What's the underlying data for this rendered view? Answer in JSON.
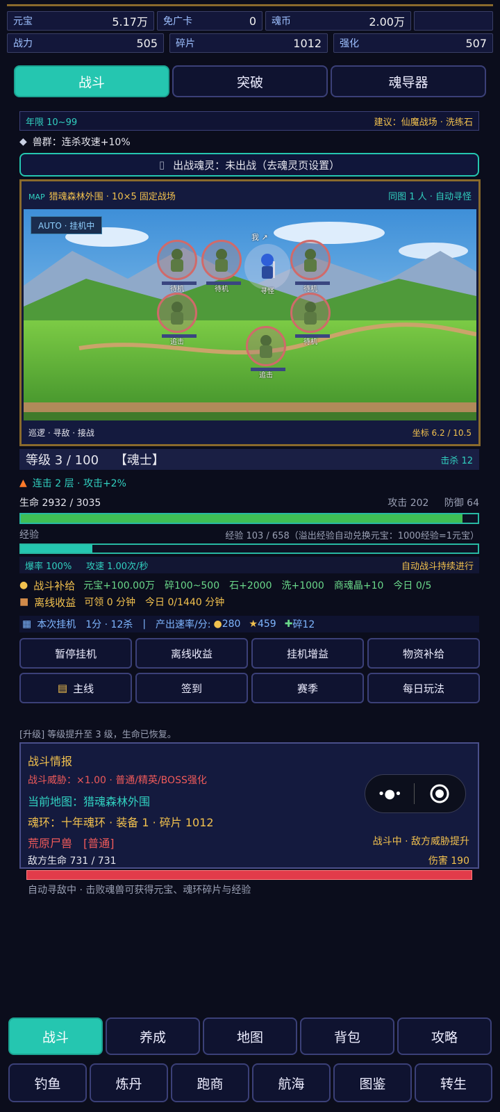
{
  "stats": [
    {
      "key": "元宝",
      "value": "5.17万"
    },
    {
      "key": "免广卡",
      "value": "0"
    },
    {
      "key": "魂币",
      "value": "2.00万"
    },
    {
      "key": "战力",
      "value": "505"
    },
    {
      "key": "碎片",
      "value": "1012"
    },
    {
      "key": "强化",
      "value": "507"
    }
  ],
  "tabs": [
    "战斗",
    "突破",
    "魂导器"
  ],
  "year_range": "年限 10~99",
  "suggest": "建议：仙魔战场 · 洗练石",
  "beast_group": "兽群：连杀攻速+10%",
  "soul_status": "出战魂灵：未出战（去魂灵页设置）",
  "map": {
    "title_prefix": "MAP",
    "title": "猎魂森林外围 · 10×5 固定战场",
    "right": "同图 1 人 · 自动寻怪",
    "auto_badge": "AUTO · 挂机中",
    "me_label": "我 ↗",
    "hero_label": "寻怪",
    "mobs": [
      "待机",
      "待机",
      "待机",
      "追击",
      "待机",
      "追击"
    ],
    "footer_left": "巡逻 · 寻敌 · 接战",
    "footer_right": "坐标 6.2 / 10.5"
  },
  "level": {
    "text": "等级 3 / 100",
    "title": "【魂士】",
    "kills": "击杀 12"
  },
  "combo": "连击 2 层 · 攻击+2%",
  "hp": {
    "label": "生命 2932 / 3035",
    "attack": "攻击 202",
    "defense": "防御 64",
    "current": 2932,
    "max": 3035
  },
  "exp": {
    "label": "经验",
    "detail": "经验 103 / 658（溢出经验自动兑换元宝：1000经验=1元宝）",
    "current": 103,
    "max": 658
  },
  "rates": {
    "left1": "爆率 100%",
    "left2": "攻速 1.00次/秒",
    "right": "自动战斗持续进行"
  },
  "supply": {
    "label": "战斗补给",
    "items": "元宝+100.00万　碎100~500　石+2000　洗+1000　商魂晶+10　今日 0/5"
  },
  "offline": {
    "label": "离线收益",
    "items": "可领 0 分钟　今日 0/1440 分钟"
  },
  "session": {
    "label": "本次挂机",
    "time": "1分 · 12杀",
    "sep": "|",
    "rate_label": "产出速率/分:",
    "gold": "280",
    "star": "459",
    "shard": "碎12"
  },
  "buttons_row1": [
    "暂停挂机",
    "离线收益",
    "挂机增益",
    "物资补给"
  ],
  "buttons_row2": [
    "主线",
    "签到",
    "赛季",
    "每日玩法"
  ],
  "log": "[升级] 等级提升至 3 级，生命已恢复。",
  "intel": {
    "title": "战斗情报",
    "threat": "战斗威胁：×1.00 · 普通/精英/BOSS强化",
    "map": "当前地图：猎魂森林外围",
    "ring": "魂环：十年魂环 · 装备 1 · 碎片 1012",
    "enemy": "荒原尸兽　[普通]",
    "status": "战斗中 · 敌方威胁提升",
    "enemy_hp": "敌方生命 731 / 731",
    "damage": "伤害 190",
    "enemy_hp_current": 731,
    "enemy_hp_max": 731
  },
  "auto_hint": "自动寻敌中 · 击败魂兽可获得元宝、魂环碎片与经验",
  "nav_main": [
    "战斗",
    "养成",
    "地图",
    "背包",
    "攻略"
  ],
  "nav_sub": [
    "钓鱼",
    "炼丹",
    "跑商",
    "航海",
    "图鉴",
    "转生"
  ]
}
